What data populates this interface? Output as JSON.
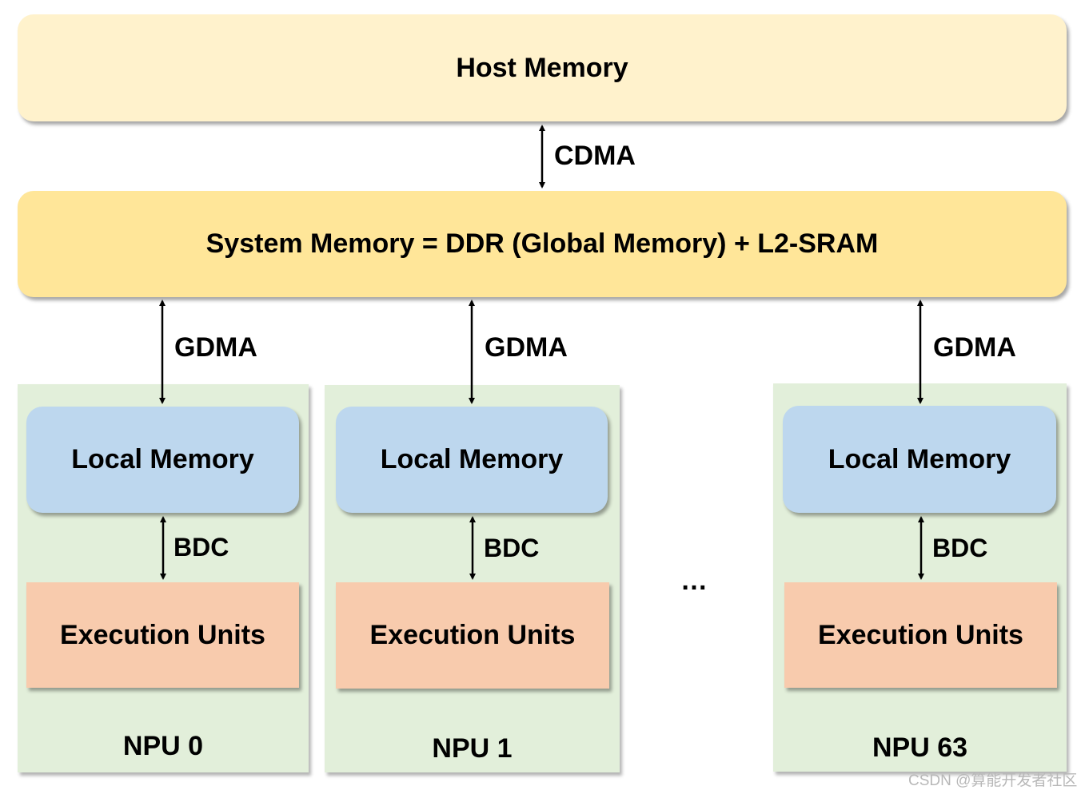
{
  "host_memory": "Host Memory",
  "cdma": "CDMA",
  "system_memory": "System Memory = DDR (Global Memory) + L2-SRAM",
  "gdma": "GDMA",
  "bdc": "BDC",
  "local_memory": "Local Memory",
  "execution_units": "Execution Units",
  "npus": [
    {
      "name": "NPU 0"
    },
    {
      "name": "NPU 1"
    },
    {
      "name": "NPU 63"
    }
  ],
  "ellipsis": "…",
  "watermark": "CSDN @算能开发者社区",
  "colors": {
    "host": "#fff2cc",
    "system": "#ffe699",
    "npu": "#e2efda",
    "local_memory": "#bdd7ee",
    "execution_units": "#f8cbad"
  }
}
